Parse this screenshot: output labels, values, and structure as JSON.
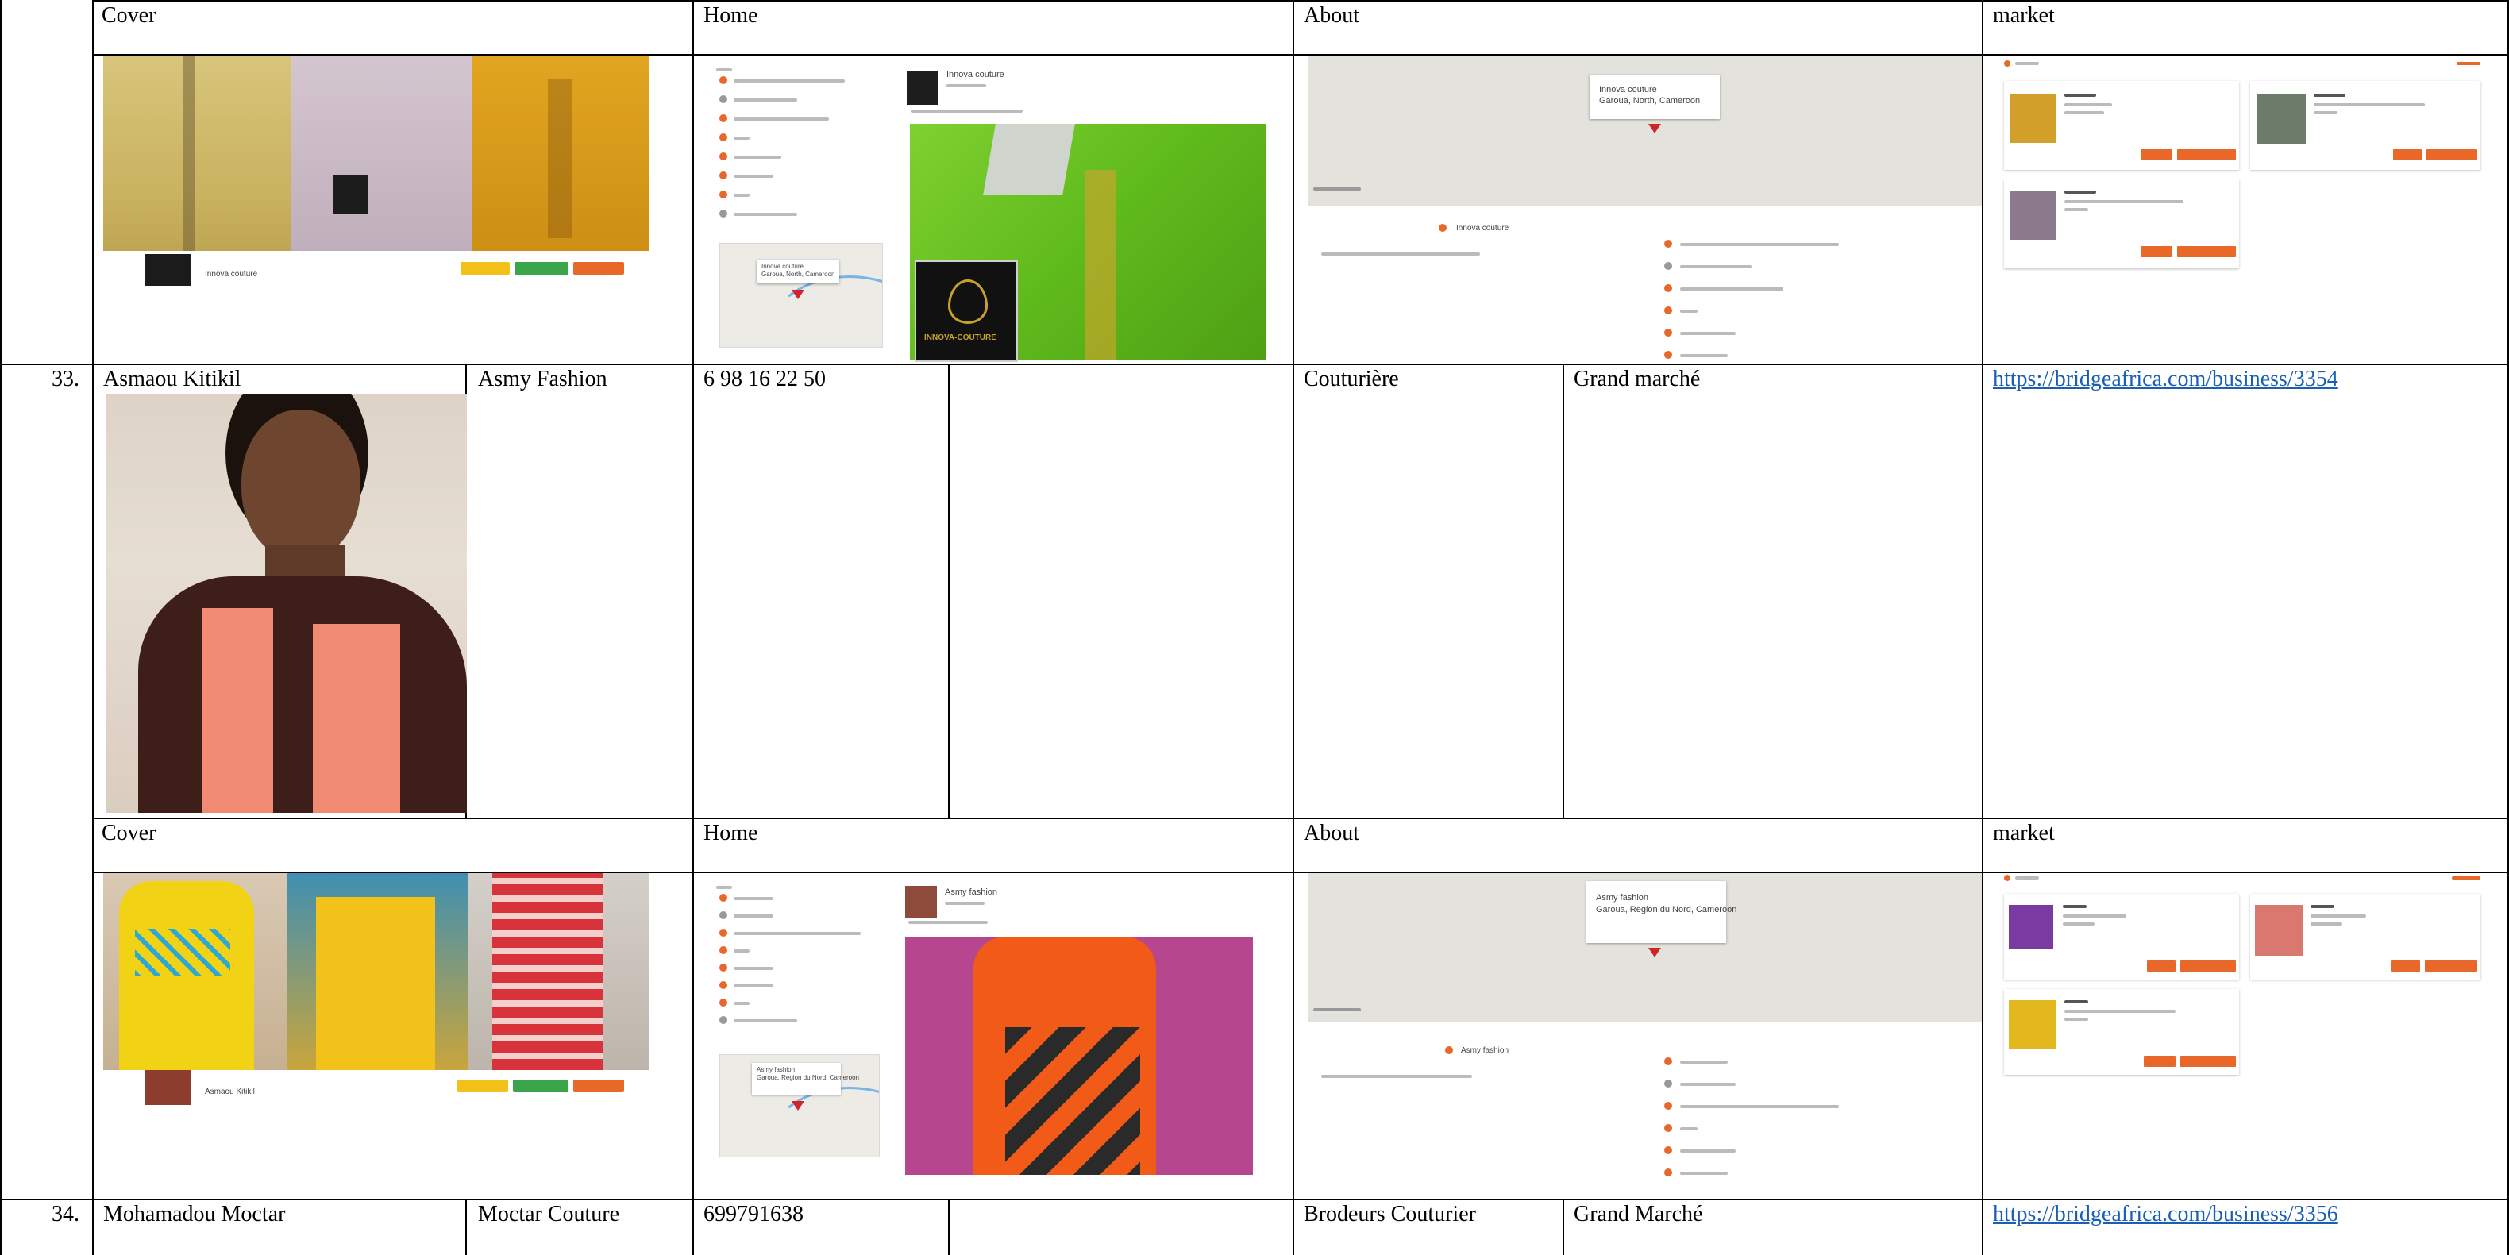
{
  "sections": {
    "cover": "Cover",
    "home": "Home",
    "about": "About",
    "market": "market"
  },
  "rows": [
    {
      "number": "33.",
      "name": "Asmaou Kitikil",
      "business": "Asmy Fashion",
      "phone": "6 98 16 22 50",
      "activity": "Couturière",
      "location": "Grand marché",
      "url": "https://bridgeafrica.com/business/3354"
    },
    {
      "number": "34.",
      "name": "Mohamadou Moctar",
      "business": "Moctar Couture",
      "phone": "699791638",
      "activity": "Brodeurs Couturier",
      "location": "Grand Marché",
      "url": "https://bridgeafrica.com/business/3356"
    }
  ],
  "thumbnails": {
    "innova": {
      "business_name": "Innova couture",
      "map_popup": "Innova couture\nGaroua, North, Cameroon",
      "logo_text": "INNOVA-COUTURE"
    },
    "asmy": {
      "business_name": "Asmy fashion",
      "map_popup": "Asmy fashion\nGaroua, Region du Nord, Cameroon",
      "cover_owner": "Asmaou Kitikil"
    }
  },
  "colors": {
    "link": "#1a5fb4",
    "accent_orange": "#e8682a"
  }
}
